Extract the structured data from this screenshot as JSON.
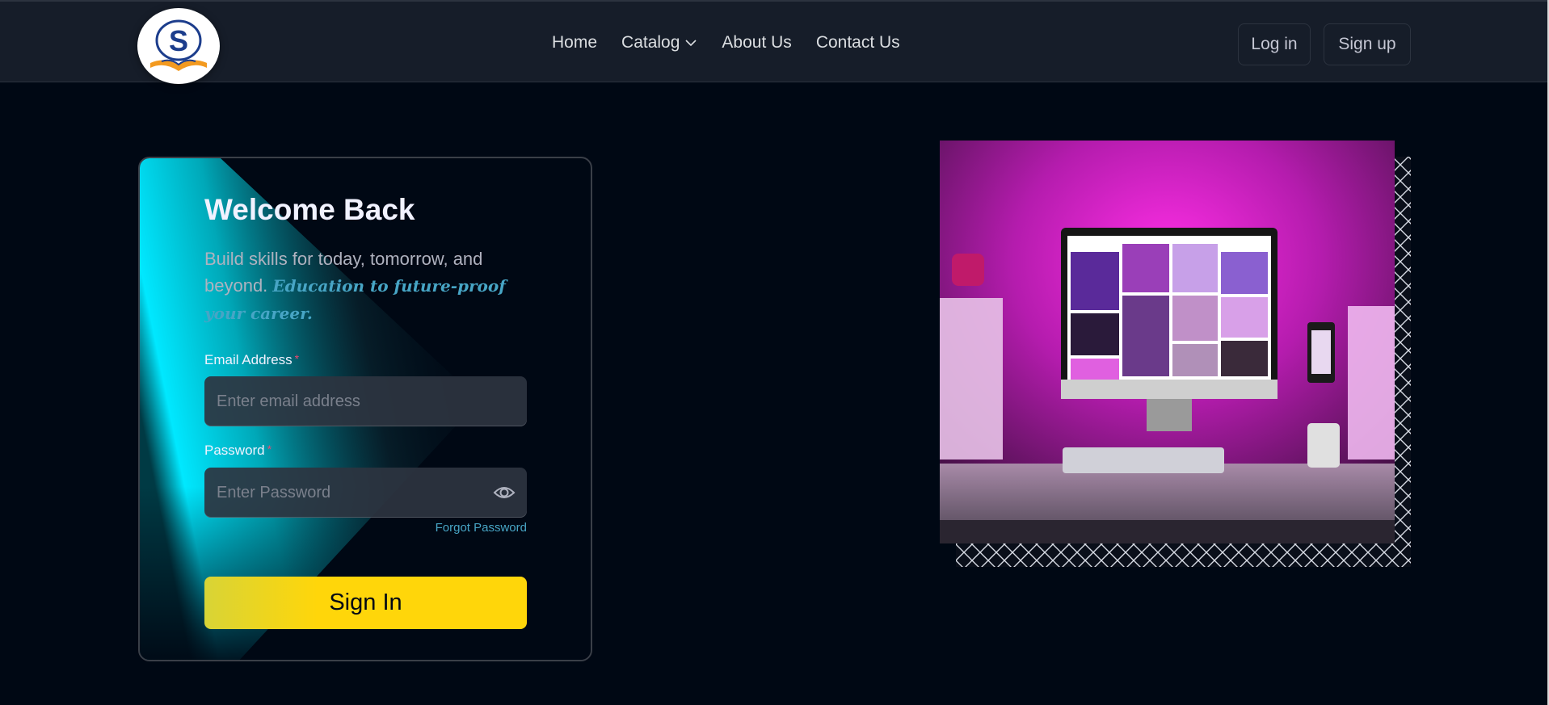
{
  "brand": {
    "logo_letter": "S",
    "logo_icon": "book-logo-icon"
  },
  "nav": {
    "links": [
      "Home",
      "Catalog",
      "About Us",
      "Contact Us"
    ],
    "catalog_icon": "chevron-down-icon",
    "login_label": "Log in",
    "signup_label": "Sign up"
  },
  "login": {
    "title": "Welcome Back",
    "subtitle": "Build skills for today, tomorrow, and beyond.",
    "subtitle_highlight": "Education to future-proof your career.",
    "email_label": "Email Address",
    "email_placeholder": "Enter email address",
    "password_label": "Password",
    "password_placeholder": "Enter Password",
    "required_mark": "*",
    "password_toggle_icon": "eye-icon",
    "forgot_label": "Forgot Password",
    "submit_label": "Sign In"
  },
  "colors": {
    "background": "#000814",
    "navbar": "#161d29",
    "accent_yellow": "#ffd60a",
    "accent_cyan": "#00e5ff",
    "link_blue": "#47a5c5",
    "photo_magenta": "#e020d8"
  }
}
